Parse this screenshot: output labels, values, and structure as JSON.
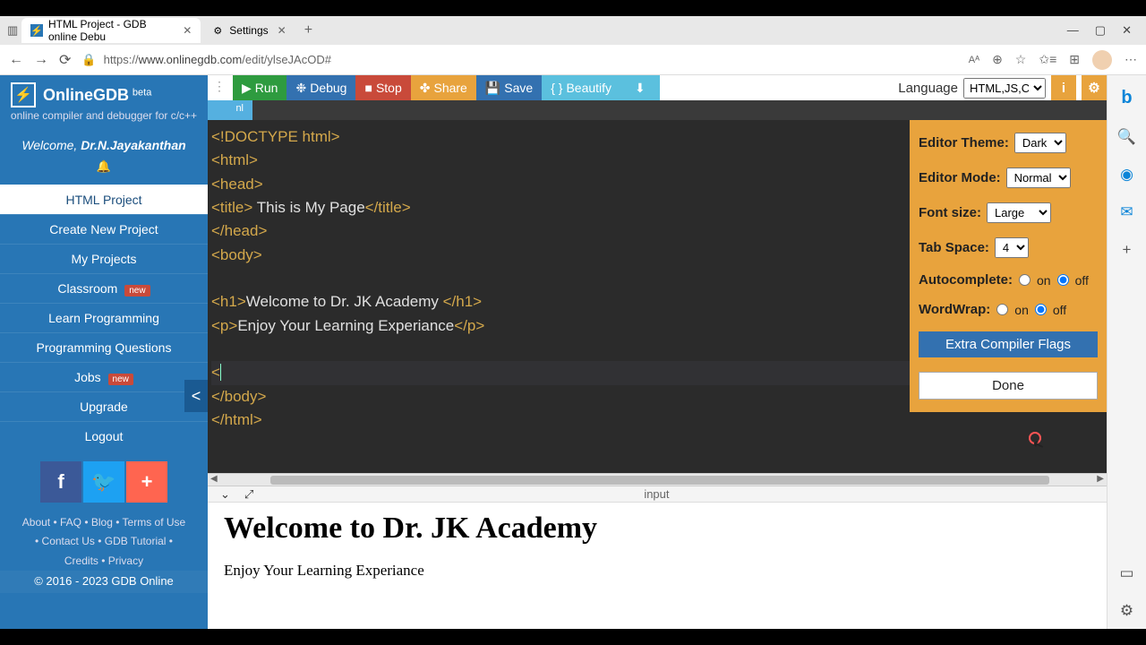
{
  "browser": {
    "tabs": [
      {
        "icon": "⚡",
        "title": "HTML Project - GDB online Debu"
      },
      {
        "icon": "⚙",
        "title": "Settings"
      }
    ],
    "url_prefix": "https://",
    "url_domain": "www.onlinegdb.com",
    "url_path": "/edit/ylseJAcOD#"
  },
  "sidebar": {
    "brand": "OnlineGDB",
    "beta": "beta",
    "tagline": "online compiler and debugger for c/c++",
    "welcome_prefix": "Welcome, ",
    "welcome_user": "Dr.N.Jayakanthan",
    "items": [
      {
        "label": "HTML Project",
        "active": true
      },
      {
        "label": "Create New Project"
      },
      {
        "label": "My Projects"
      },
      {
        "label": "Classroom",
        "badge": "new"
      },
      {
        "label": "Learn Programming"
      },
      {
        "label": "Programming Questions"
      },
      {
        "label": "Jobs",
        "badge": "new"
      },
      {
        "label": "Upgrade"
      },
      {
        "label": "Logout"
      }
    ],
    "footer1": "About • FAQ • Blog • Terms of Use",
    "footer2": "• Contact Us • GDB Tutorial •",
    "footer3": "Credits • Privacy",
    "copyright": "© 2016 - 2023 GDB Online"
  },
  "toolbar": {
    "run": "Run",
    "debug": "Debug",
    "stop": "Stop",
    "share": "Share",
    "save": "Save",
    "beautify": "Beautify",
    "language_label": "Language",
    "language_value": "HTML,JS,CSS"
  },
  "file_tab": "nl",
  "code_lines": [
    {
      "t": "tag",
      "v": "<!DOCTYPE html>"
    },
    {
      "t": "tag",
      "v": "<html>"
    },
    {
      "t": "tag",
      "v": "<head>"
    },
    {
      "t": "mix",
      "open": "<title>",
      "text": " This is My Page",
      "close": "</title>"
    },
    {
      "t": "tag",
      "v": "</head>"
    },
    {
      "t": "tag",
      "v": "<body>"
    },
    {
      "t": "blank"
    },
    {
      "t": "mix",
      "open": "<h1>",
      "text": "Welcome to Dr. JK Academy ",
      "close": "</h1>"
    },
    {
      "t": "mix",
      "open": "<p>",
      "text": "Enjoy Your Learning Experiance",
      "close": "</p>"
    },
    {
      "t": "blank"
    },
    {
      "t": "cursor",
      "v": "<"
    },
    {
      "t": "tag",
      "v": "</body>"
    },
    {
      "t": "tag",
      "v": "</html>"
    }
  ],
  "settings": {
    "theme_label": "Editor Theme:",
    "theme_value": "Dark",
    "mode_label": "Editor Mode:",
    "mode_value": "Normal",
    "font_label": "Font size:",
    "font_value": "Large",
    "tab_label": "Tab Space:",
    "tab_value": "4",
    "auto_label": "Autocomplete:",
    "on": "on",
    "off": "off",
    "wrap_label": "WordWrap:",
    "extra": "Extra Compiler Flags",
    "done": "Done"
  },
  "collapsed": {
    "input": "input"
  },
  "output": {
    "h1": "Welcome to Dr. JK Academy",
    "p": "Enjoy Your Learning Experiance"
  }
}
